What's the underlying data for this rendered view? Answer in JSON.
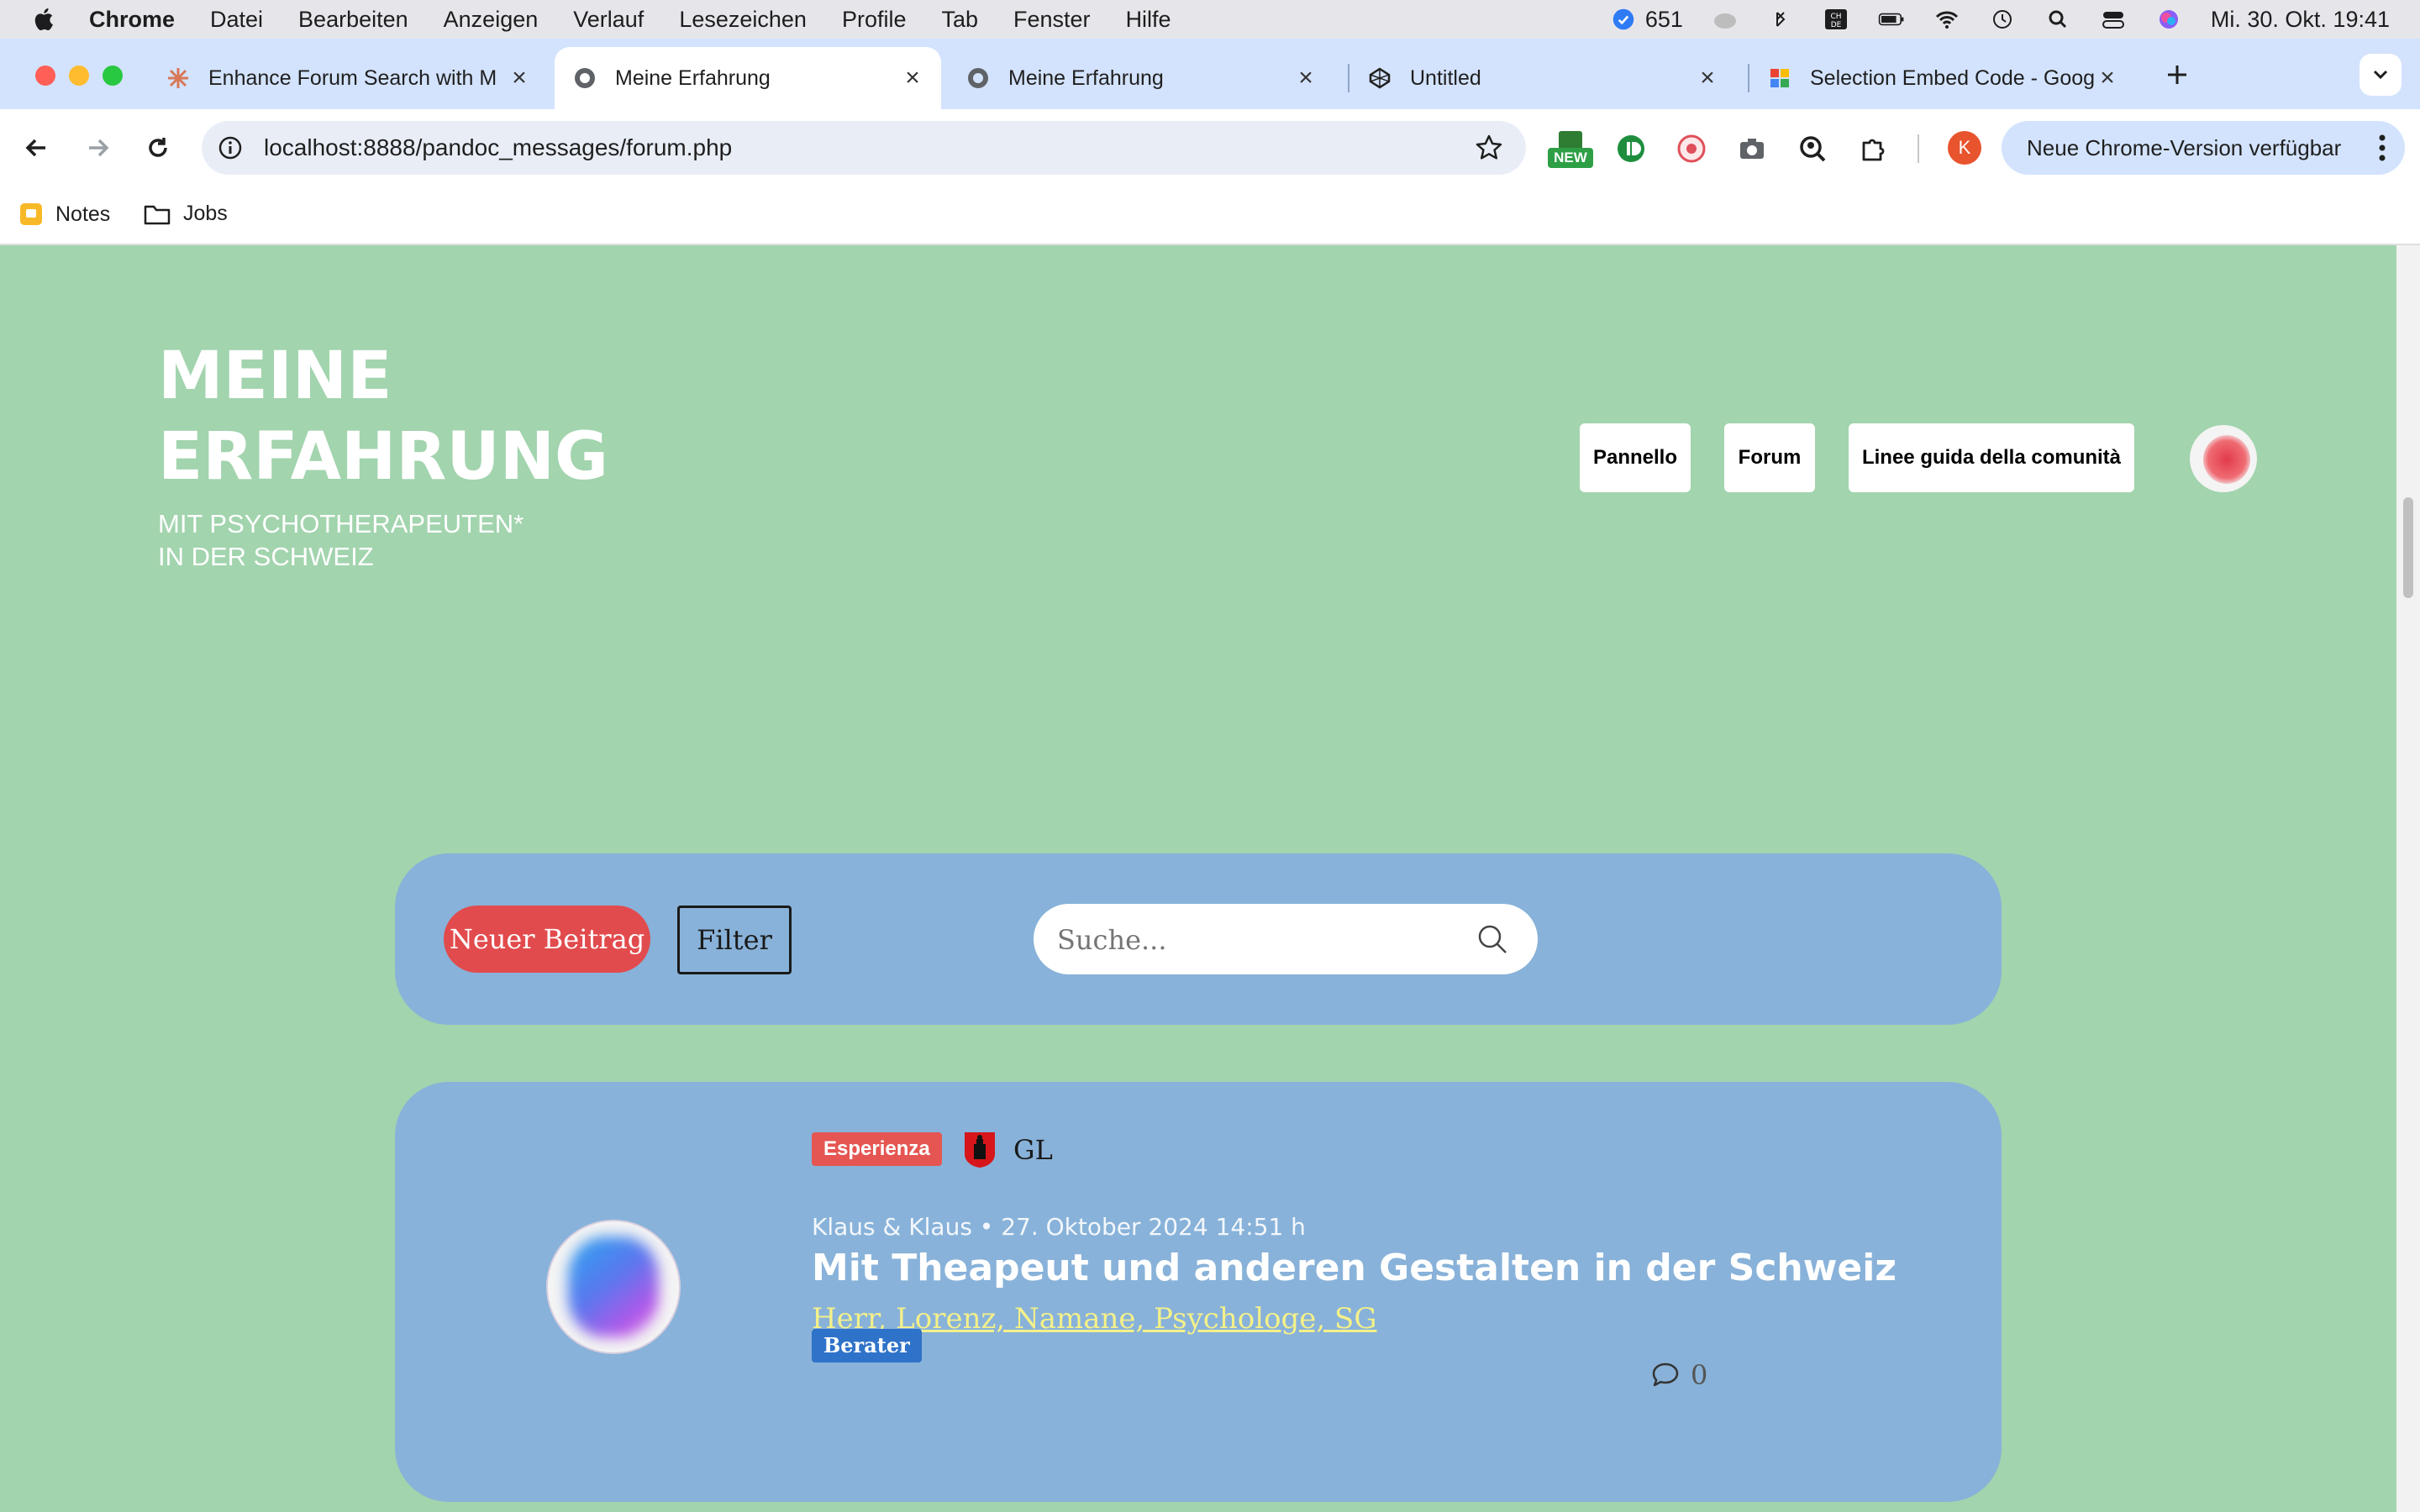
{
  "menubar": {
    "app": "Chrome",
    "items": [
      "Datei",
      "Bearbeiten",
      "Anzeigen",
      "Verlauf",
      "Lesezeichen",
      "Profile",
      "Tab",
      "Fenster",
      "Hilfe"
    ],
    "mail_count": "651",
    "datetime": "Mi. 30. Okt.  19:41"
  },
  "tabs": [
    {
      "title": "Enhance Forum Search with M"
    },
    {
      "title": "Meine Erfahrung"
    },
    {
      "title": "Meine Erfahrung"
    },
    {
      "title": "Untitled"
    },
    {
      "title": "Selection Embed Code - Goog"
    }
  ],
  "toolbar": {
    "url": "localhost:8888/pandoc_messages/forum.php",
    "update_label": "Neue Chrome-Version verfügbar",
    "profile_initial": "K",
    "ext_new_badge": "NEW"
  },
  "bookmarks": [
    {
      "label": "Notes"
    },
    {
      "label": "Jobs"
    }
  ],
  "site": {
    "logo_line1": "MEINE",
    "logo_line2": "ERFAHRUNG",
    "subtitle_line1": "MIT PSYCHOTHERAPEUTEN*",
    "subtitle_line2": "IN DER SCHWEIZ",
    "nav": [
      "Pannello",
      "Forum",
      "Linee guida della comunità"
    ]
  },
  "actions": {
    "new_post": "Neuer Beitrag",
    "filter": "Filter",
    "search_placeholder": "Suche..."
  },
  "post": {
    "category": "Esperienza",
    "canton": "GL",
    "meta": "Klaus & Klaus • 27. Oktober 2024 14:51 h",
    "title": "Mit Theapeut und anderen Gestalten in der Schweiz",
    "therapist": "Herr, Lorenz, Namane, Psychologe, SG",
    "role": "Berater",
    "comment_count": "0"
  },
  "colors": {
    "page_bg": "#a2d4ae",
    "panel_bg": "#88b2d9",
    "accent_red": "#e24b4d",
    "role_blue": "#2f72c9",
    "link_yellow": "#f4f08a"
  }
}
